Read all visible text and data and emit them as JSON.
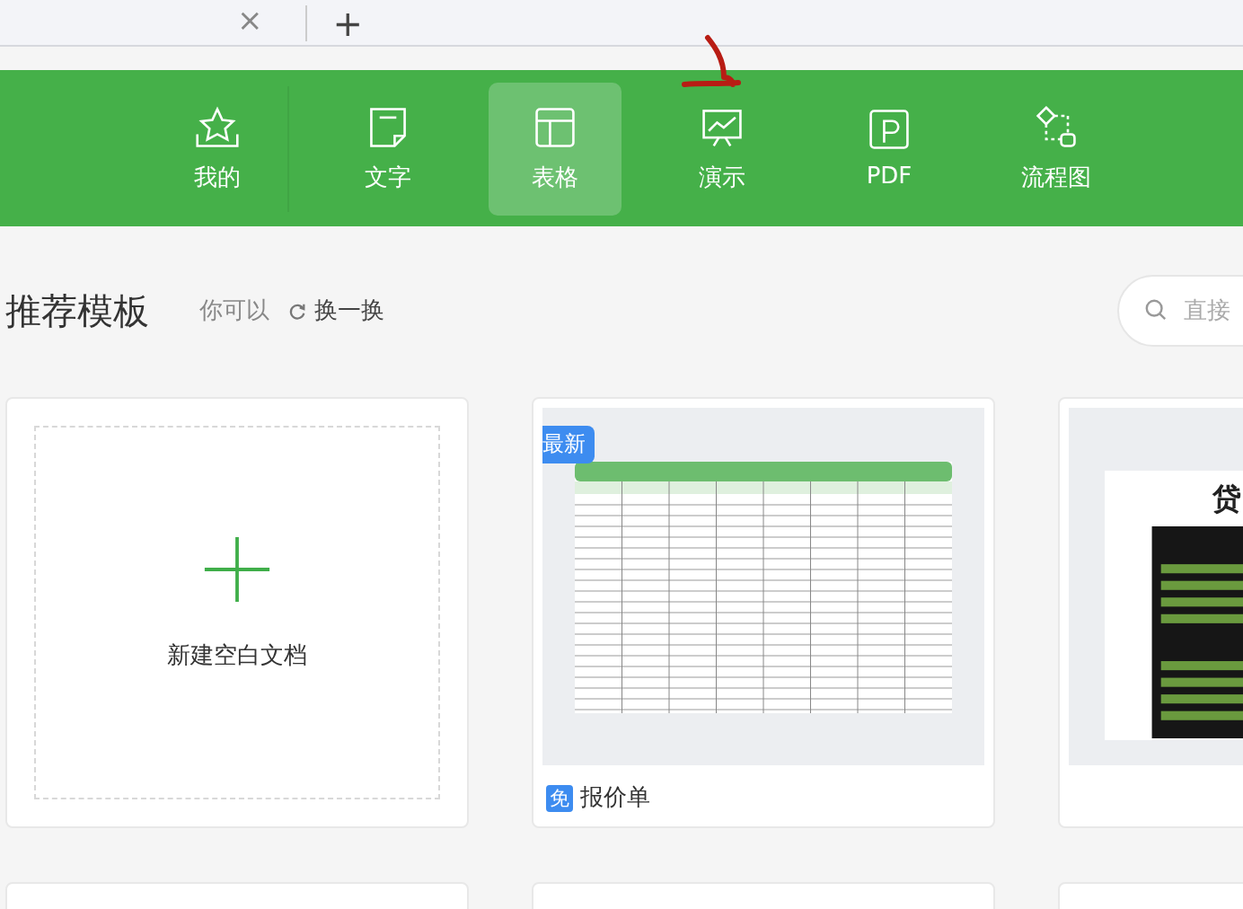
{
  "tabbar": {
    "close": "×",
    "new_tab": "+"
  },
  "nav": [
    {
      "label": "我的",
      "selected": false
    },
    {
      "label": "文字",
      "selected": false
    },
    {
      "label": "表格",
      "selected": true
    },
    {
      "label": "演示",
      "selected": false
    },
    {
      "label": "PDF",
      "selected": false
    },
    {
      "label": "流程图",
      "selected": false
    }
  ],
  "section": {
    "title": "推荐模板",
    "hint": "你可以",
    "refresh": "换一换",
    "search": {
      "placeholder": "直接"
    }
  },
  "cards": [
    {
      "kind": "blank",
      "label": "新建空白文档"
    },
    {
      "kind": "sheet",
      "badge": "最新",
      "free_tag": "免",
      "label": "报价单"
    },
    {
      "kind": "loan",
      "preview_title": "贷"
    }
  ]
}
